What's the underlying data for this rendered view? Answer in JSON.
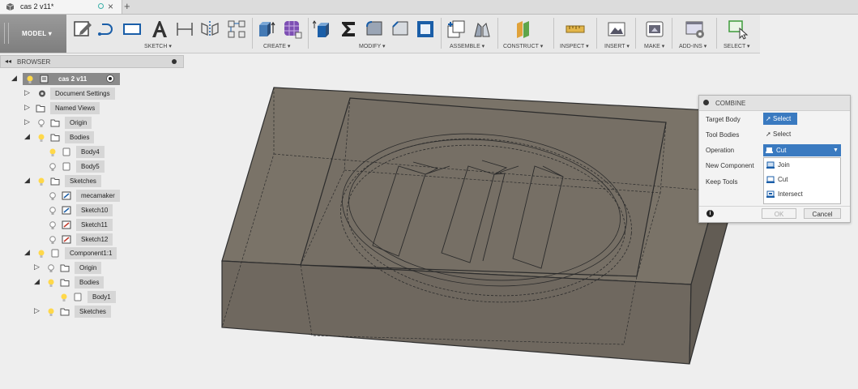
{
  "tab": {
    "title": "cas 2 v11*",
    "close": "×",
    "add": "+"
  },
  "toolbar": {
    "workspace": "MODEL ▾",
    "groups": {
      "sketch": "SKETCH ▾",
      "create": "CREATE ▾",
      "modify": "MODIFY ▾",
      "assemble": "ASSEMBLE ▾",
      "construct": "CONSTRUCT ▾",
      "inspect": "INSPECT ▾",
      "insert": "INSERT ▾",
      "make": "MAKE ▾",
      "addins": "ADD-INS ▾",
      "select": "SELECT ▾"
    }
  },
  "browser": {
    "collapse": "◂◂",
    "title": "BROWSER",
    "root": "cas 2 v11",
    "items": {
      "doc_settings": "Document Settings",
      "named_views": "Named Views",
      "origin": "Origin",
      "bodies": "Bodies",
      "body4": "Body4",
      "body5": "Body5",
      "sketches": "Sketches",
      "mecamaker": "mecamaker",
      "sketch10": "Sketch10",
      "sketch11": "Sketch11",
      "sketch12": "Sketch12",
      "component": "Component1:1",
      "c_origin": "Origin",
      "c_bodies": "Bodies",
      "c_body1": "Body1",
      "c_sketches": "Sketches"
    }
  },
  "combine": {
    "title": "COMBINE",
    "target_label": "Target Body",
    "target_btn": "Select",
    "tool_label": "Tool Bodies",
    "tool_btn": "Select",
    "op_label": "Operation",
    "op_value": "Cut",
    "options": {
      "join": "Join",
      "cut": "Cut",
      "intersect": "Intersect"
    },
    "new_comp_label": "New Component",
    "keep_tools_label": "Keep Tools",
    "ok": "OK",
    "cancel": "Cancel"
  },
  "colors": {
    "accent": "#3a7ac0",
    "body_fill": "#7a7368"
  }
}
